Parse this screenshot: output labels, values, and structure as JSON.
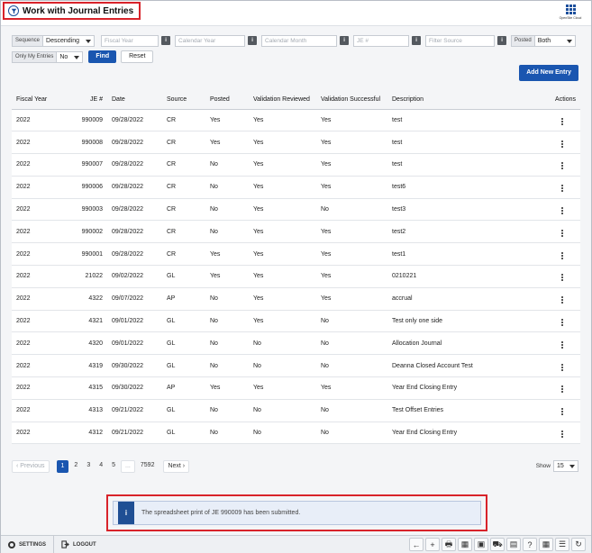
{
  "header": {
    "title": "Work with Journal Entries",
    "launcher_label": "OpenSite Cloud"
  },
  "filters": {
    "sequence_label": "Sequence",
    "sequence_value": "Descending",
    "fiscal_year_placeholder": "Fiscal Year",
    "calendar_year_placeholder": "Calendar Year",
    "calendar_month_placeholder": "Calendar Month",
    "je_placeholder": "JE #",
    "filter_source_placeholder": "Filter Source",
    "posted_label": "Posted",
    "posted_value": "Both",
    "only_my_entries_label": "Only My Entries",
    "only_my_entries_value": "No",
    "find_label": "Find",
    "reset_label": "Reset",
    "info_glyph": "i"
  },
  "add_button_label": "Add New Entry",
  "table": {
    "headers": [
      "Fiscal Year",
      "JE #",
      "Date",
      "Source",
      "Posted",
      "Validation Reviewed",
      "Validation Successful",
      "Description",
      "Actions"
    ],
    "rows": [
      [
        "2022",
        "990009",
        "09/28/2022",
        "CR",
        "Yes",
        "Yes",
        "Yes",
        "test"
      ],
      [
        "2022",
        "990008",
        "09/28/2022",
        "CR",
        "Yes",
        "Yes",
        "Yes",
        "test"
      ],
      [
        "2022",
        "990007",
        "09/28/2022",
        "CR",
        "No",
        "Yes",
        "Yes",
        "test"
      ],
      [
        "2022",
        "990006",
        "09/28/2022",
        "CR",
        "No",
        "Yes",
        "Yes",
        "test6"
      ],
      [
        "2022",
        "990003",
        "09/28/2022",
        "CR",
        "No",
        "Yes",
        "No",
        "test3"
      ],
      [
        "2022",
        "990002",
        "09/28/2022",
        "CR",
        "No",
        "Yes",
        "Yes",
        "test2"
      ],
      [
        "2022",
        "990001",
        "09/28/2022",
        "CR",
        "Yes",
        "Yes",
        "Yes",
        "test1"
      ],
      [
        "2022",
        "21022",
        "09/02/2022",
        "GL",
        "Yes",
        "Yes",
        "Yes",
        "0210221"
      ],
      [
        "2022",
        "4322",
        "09/07/2022",
        "AP",
        "No",
        "Yes",
        "Yes",
        "accrual"
      ],
      [
        "2022",
        "4321",
        "09/01/2022",
        "GL",
        "No",
        "Yes",
        "No",
        "Test only one side"
      ],
      [
        "2022",
        "4320",
        "09/01/2022",
        "GL",
        "No",
        "No",
        "No",
        "Allocation Journal"
      ],
      [
        "2022",
        "4319",
        "09/30/2022",
        "GL",
        "No",
        "No",
        "No",
        "Deanna Closed Account Test"
      ],
      [
        "2022",
        "4315",
        "09/30/2022",
        "AP",
        "Yes",
        "Yes",
        "Yes",
        "Year End Closing Entry"
      ],
      [
        "2022",
        "4313",
        "09/21/2022",
        "GL",
        "No",
        "No",
        "No",
        "Test Offset Entries"
      ],
      [
        "2022",
        "4312",
        "09/21/2022",
        "GL",
        "No",
        "No",
        "No",
        "Year End Closing Entry"
      ]
    ]
  },
  "pagination": {
    "previous_label": "‹ Previous",
    "pages": [
      "1",
      "2",
      "3",
      "4",
      "5",
      "...",
      "7592"
    ],
    "active_page": "1",
    "next_label": "Next ›",
    "show_label": "Show",
    "show_value": "15"
  },
  "notification": {
    "icon": "i",
    "text": "The spreadsheet print of JE 990009 has been submitted."
  },
  "bottombar": {
    "settings_label": "SETTINGS",
    "logout_label": "LOGOUT",
    "tools": [
      "←",
      "+",
      "🖶",
      "▦",
      "▣",
      "⛟",
      "▤",
      "?",
      "▦",
      "☰",
      "↻"
    ]
  },
  "colors": {
    "accent": "#1a56b0",
    "highlight": "#d8232a"
  }
}
